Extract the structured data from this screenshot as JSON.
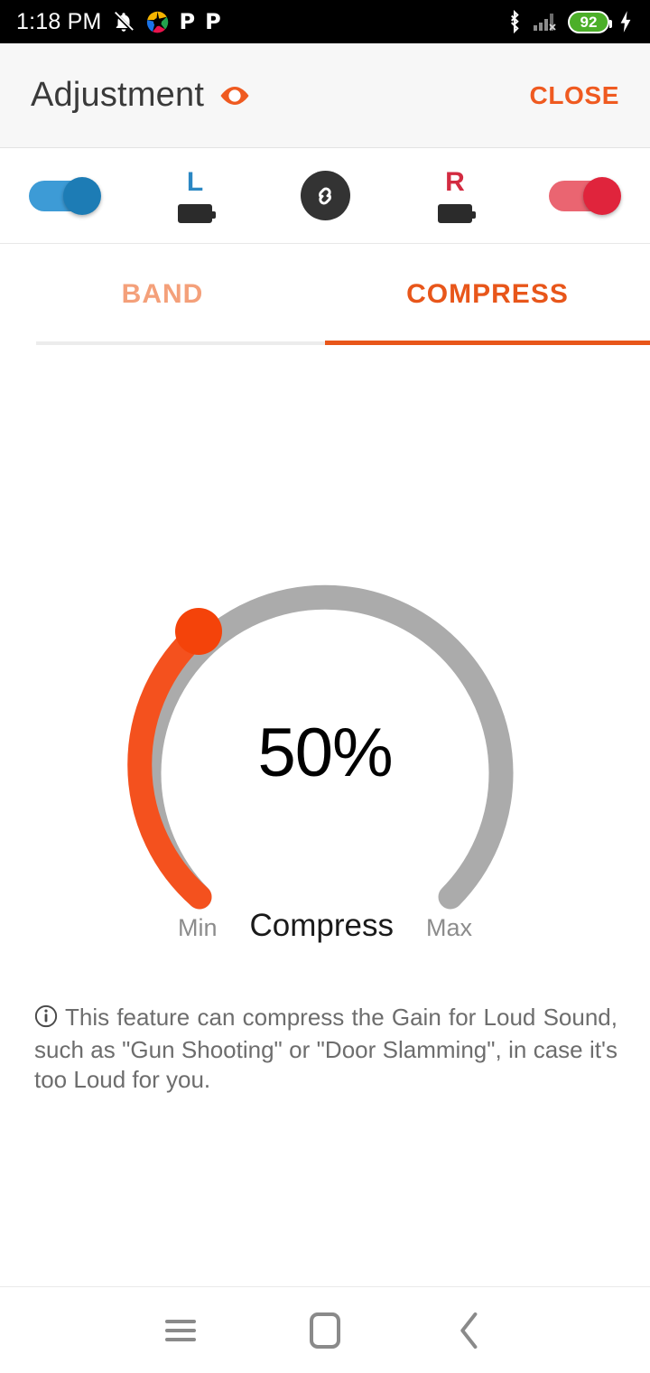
{
  "statusbar": {
    "time": "1:18 PM",
    "icons_left": [
      "vibrate-off-icon",
      "shutter-logo-icon",
      "p-app-icon",
      "p-app-icon-2"
    ],
    "p_label": "P",
    "icons_right": [
      "bluetooth-icon",
      "signal-no-sim-icon",
      "battery-icon",
      "charging-bolt-icon"
    ],
    "battery_level": "92"
  },
  "appbar": {
    "title": "Adjustment",
    "eye_icon": "eye-icon",
    "close_label": "CLOSE",
    "accent_color": "#ef5a20"
  },
  "device_row": {
    "left_toggle": {
      "name": "left-ear-toggle",
      "state": "on",
      "color": "#1d7cb5"
    },
    "left_side": {
      "label": "L",
      "color": "#2b87c3",
      "battery_icon": "battery-full-icon"
    },
    "link_button": {
      "icon": "chain-link-icon",
      "state": "linked",
      "color": "#333333"
    },
    "right_side": {
      "label": "R",
      "color": "#d32b41",
      "battery_icon": "battery-full-icon"
    },
    "right_toggle": {
      "name": "right-ear-toggle",
      "state": "on",
      "color": "#e0243c"
    }
  },
  "tabs": [
    {
      "label": "BAND",
      "active": false
    },
    {
      "label": "COMPRESS",
      "active": true
    }
  ],
  "gauge": {
    "value_text": "50%",
    "value": 50,
    "min_label": "Min",
    "center_label": "Compress",
    "max_label": "Max",
    "fill_color": "#f4511e",
    "track_color": "#ababab",
    "thumb_color": "#f4430a"
  },
  "info": {
    "icon": "info-circle-icon",
    "text": "This feature can compress the Gain for Loud Sound, such as \"Gun Shooting\" or \"Door Slamming\", in case it's too Loud for you."
  },
  "navbar": {
    "recents": "recents-icon",
    "home": "home-icon",
    "back": "back-icon"
  },
  "chart_data": {
    "type": "gauge",
    "title": "Compress",
    "value": 50,
    "unit": "%",
    "min": 0,
    "max": 100,
    "min_label": "Min",
    "max_label": "Max",
    "display": "50%"
  }
}
